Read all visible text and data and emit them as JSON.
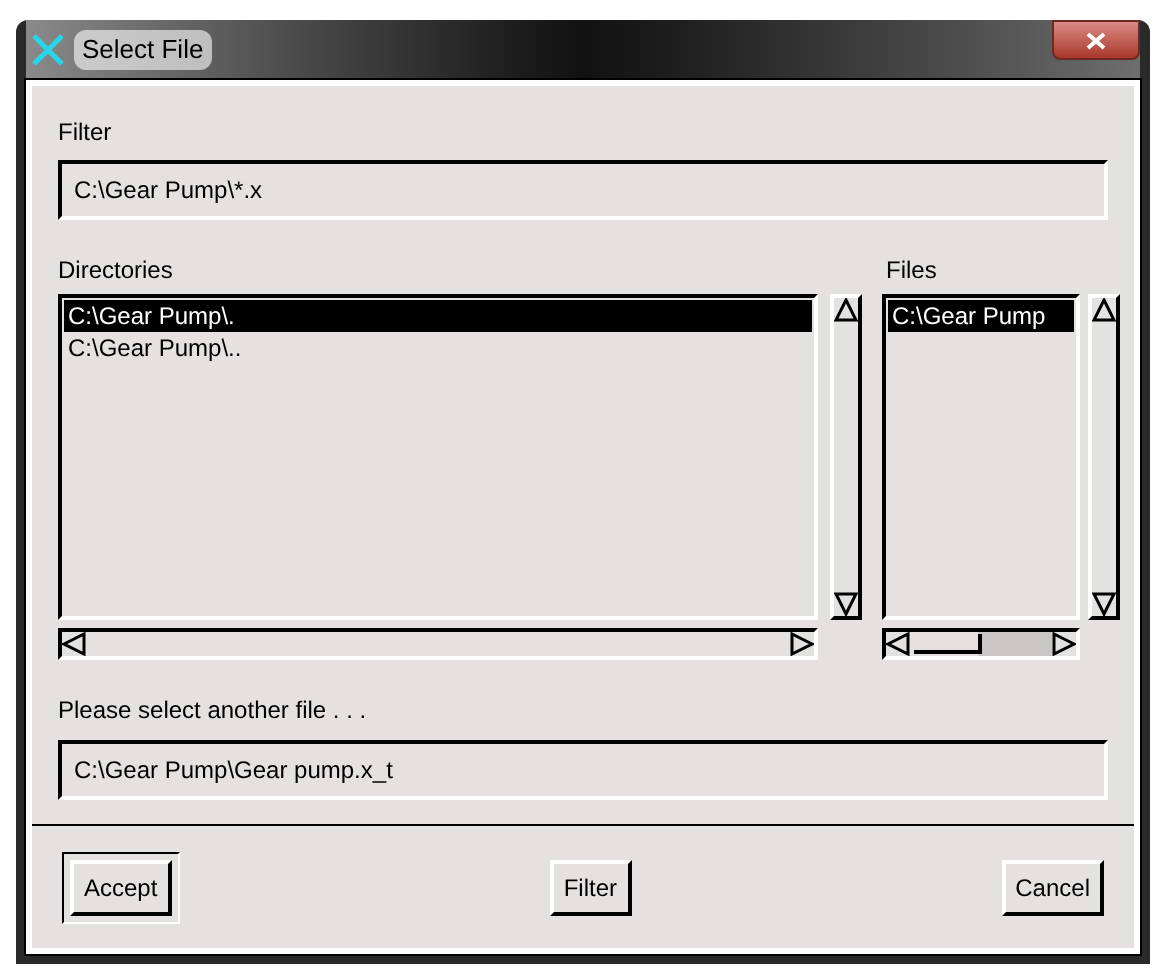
{
  "window": {
    "title": "Select File"
  },
  "filter": {
    "label": "Filter",
    "value": "C:\\Gear Pump\\*.x"
  },
  "directories": {
    "label": "Directories",
    "items": [
      {
        "text": "C:\\Gear Pump\\.",
        "selected": true
      },
      {
        "text": "C:\\Gear Pump\\..",
        "selected": false
      }
    ]
  },
  "files": {
    "label": "Files",
    "items": [
      {
        "text": "C:\\Gear Pump",
        "selected": true
      }
    ]
  },
  "selection": {
    "label": "Please select another file . . .",
    "value": "C:\\Gear Pump\\Gear pump.x_t"
  },
  "buttons": [
    {
      "label": "Accept",
      "default": true
    },
    {
      "label": "Filter",
      "default": false
    },
    {
      "label": "Cancel",
      "default": false
    }
  ]
}
